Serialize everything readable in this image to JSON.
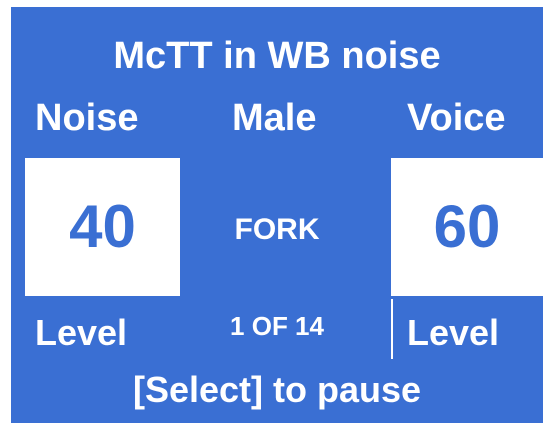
{
  "title": "McTT in WB noise",
  "headers": {
    "left": "Noise",
    "center": "Male",
    "right": "Voice"
  },
  "noise_level": "40",
  "voice_level": "60",
  "current_word": "FORK",
  "progress": "1 OF 14",
  "level_labels": {
    "left": "Level",
    "right": "Level"
  },
  "instruction": "[Select] to pause",
  "colors": {
    "background": "#3a6fd3",
    "text": "#ffffff",
    "box": "#ffffff",
    "box_text": "#3a6fd3"
  }
}
